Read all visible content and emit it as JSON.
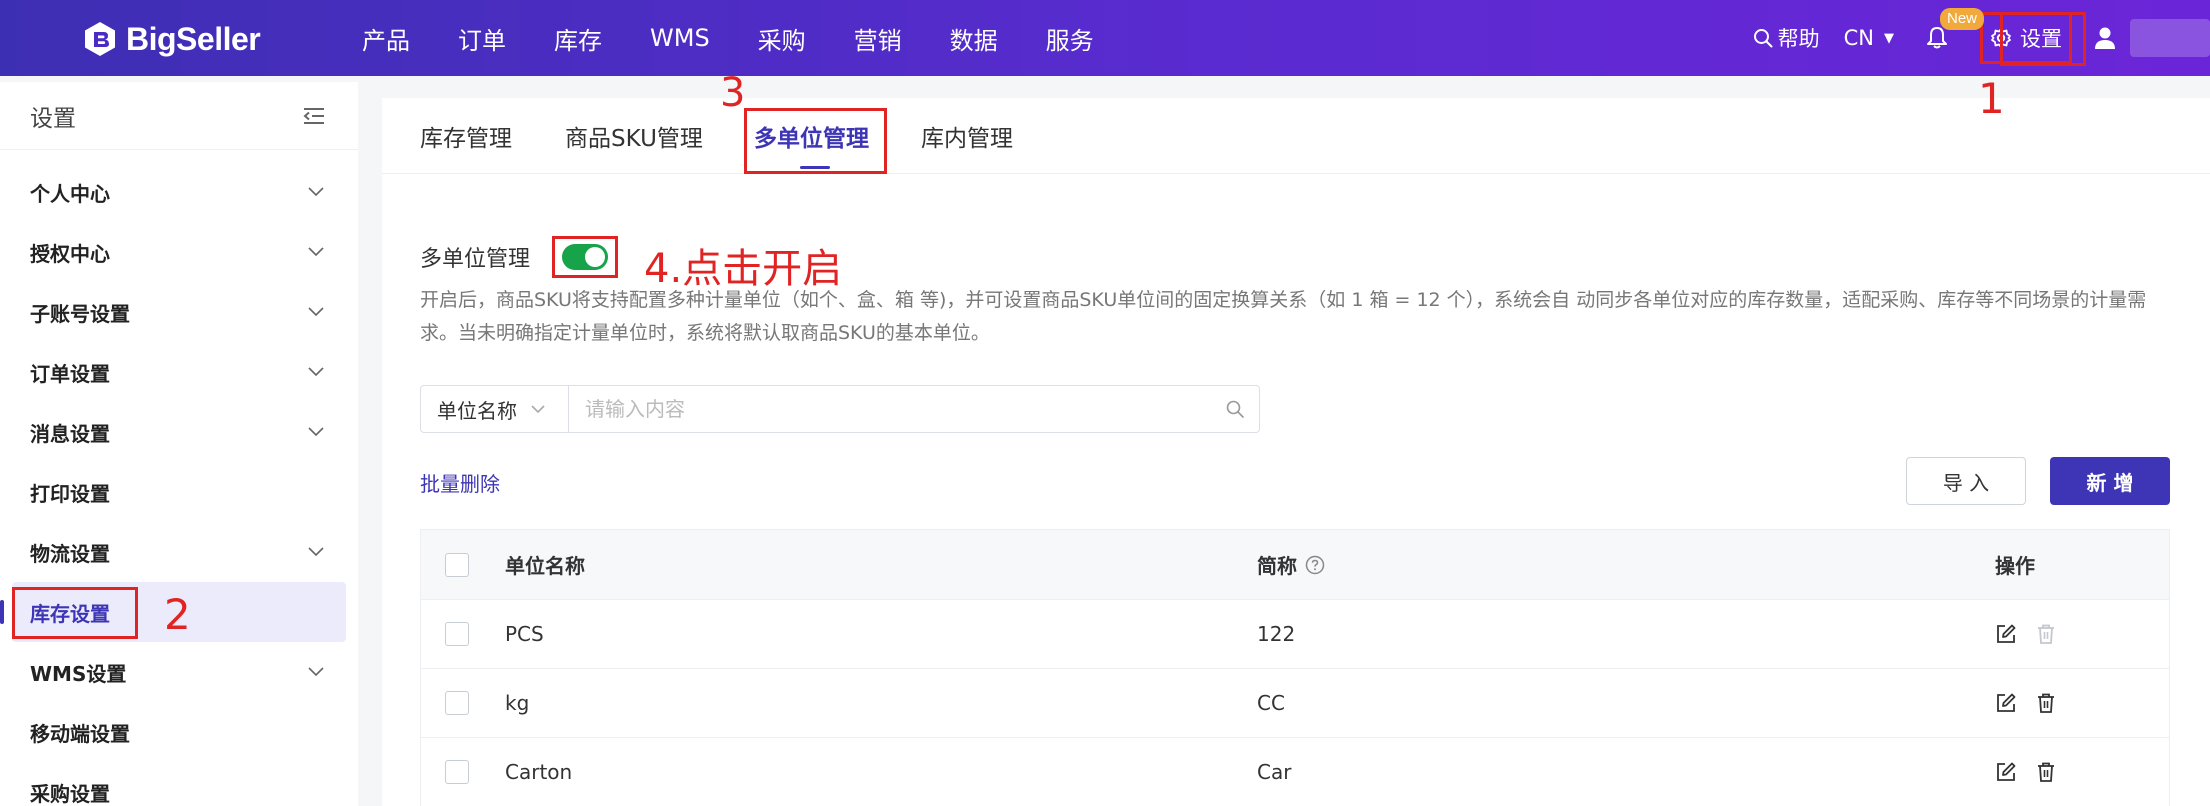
{
  "brand": {
    "name": "BigSeller"
  },
  "nav": [
    "产品",
    "订单",
    "库存",
    "WMS",
    "采购",
    "营销",
    "数据",
    "服务"
  ],
  "topright": {
    "help": "帮助",
    "lang": "CN",
    "badge": "New",
    "settings": "设置"
  },
  "sidebar": {
    "title": "设置",
    "items": [
      {
        "label": "个人中心",
        "chevron": true
      },
      {
        "label": "授权中心",
        "chevron": true
      },
      {
        "label": "子账号设置",
        "chevron": true
      },
      {
        "label": "订单设置",
        "chevron": true
      },
      {
        "label": "消息设置",
        "chevron": true
      },
      {
        "label": "打印设置",
        "chevron": false
      },
      {
        "label": "物流设置",
        "chevron": true
      },
      {
        "label": "库存设置",
        "chevron": false,
        "active": true
      },
      {
        "label": "WMS设置",
        "chevron": true
      },
      {
        "label": "移动端设置",
        "chevron": false
      },
      {
        "label": "采购设置",
        "chevron": false
      }
    ]
  },
  "tabs": [
    "库存管理",
    "商品SKU管理",
    "多单位管理",
    "库内管理"
  ],
  "active_tab": "多单位管理",
  "section": {
    "title": "多单位管理",
    "toggle_on": true,
    "description": "开启后，商品SKU将支持配置多种计量单位（如个、盒、箱 等)，并可设置商品SKU单位间的固定换算关系（如 1 箱 = 12 个），系统会自 动同步各单位对应的库存数量，适配采购、库存等不同场景的计量需求。当未明确指定计量单位时，系统将默认取商品SKU的基本单位。"
  },
  "search": {
    "select_value": "单位名称",
    "placeholder": "请输入内容"
  },
  "actions": {
    "batch_delete": "批量删除",
    "import": "导 入",
    "add": "新 增"
  },
  "table": {
    "headers": {
      "name": "单位名称",
      "abbr": "简称",
      "ops": "操作"
    },
    "rows": [
      {
        "name": "PCS",
        "abbr": "122",
        "delete_disabled": true
      },
      {
        "name": "kg",
        "abbr": "CC",
        "delete_disabled": false
      },
      {
        "name": "Carton",
        "abbr": "Car",
        "delete_disabled": false
      }
    ]
  },
  "annotations": {
    "step1": "1",
    "step2": "2",
    "step3": "3",
    "step4": "4.点击开启"
  },
  "colors": {
    "topbar_start": "#3d2fb3",
    "topbar_end": "#6b25d8",
    "primary": "#3d35b5",
    "toggle_on": "#16a34a",
    "annotation_red": "#e02424",
    "badge": "#f2a93b"
  }
}
